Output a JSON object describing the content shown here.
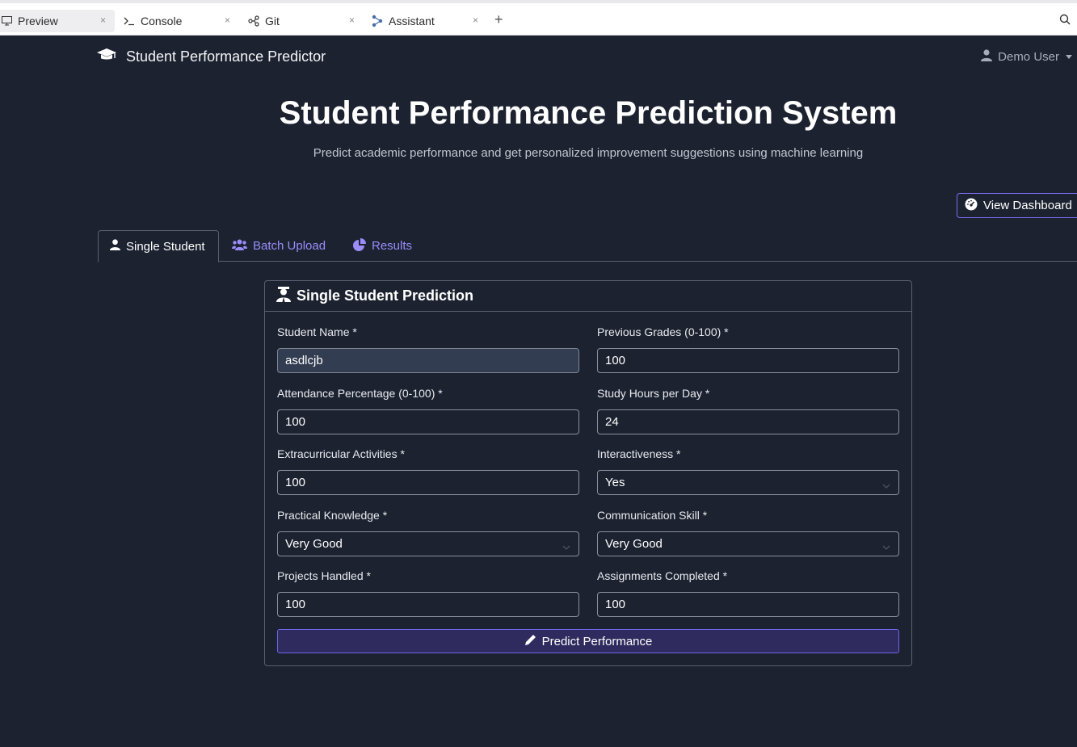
{
  "ide": {
    "tabs": [
      {
        "label": "Preview",
        "icon": "monitor-icon"
      },
      {
        "label": "Console",
        "icon": "terminal-icon"
      },
      {
        "label": "Git",
        "icon": "git-icon"
      },
      {
        "label": "Assistant",
        "icon": "assistant-icon"
      }
    ],
    "close_glyph": "×",
    "new_tab_glyph": "+"
  },
  "navbar": {
    "brand": "Student Performance Predictor",
    "user": "Demo User"
  },
  "hero": {
    "title": "Student Performance Prediction System",
    "subtitle": "Predict academic performance and get personalized improvement suggestions using machine learning"
  },
  "dashboard_button": "View Dashboard",
  "tabs": [
    {
      "label": "Single Student",
      "active": true
    },
    {
      "label": "Batch Upload",
      "active": false
    },
    {
      "label": "Results",
      "active": false
    }
  ],
  "form": {
    "title": "Single Student Prediction",
    "fields": {
      "student_name": {
        "label": "Student Name *",
        "value": "asdlcjb"
      },
      "previous_grades": {
        "label": "Previous Grades (0-100) *",
        "value": "100"
      },
      "attendance": {
        "label": "Attendance Percentage (0-100) *",
        "value": "100"
      },
      "study_hours": {
        "label": "Study Hours per Day *",
        "value": "24"
      },
      "extracurricular": {
        "label": "Extracurricular Activities *",
        "value": "100"
      },
      "interactiveness": {
        "label": "Interactiveness *",
        "value": "Yes"
      },
      "practical_knowledge": {
        "label": "Practical Knowledge *",
        "value": "Very Good"
      },
      "communication_skill": {
        "label": "Communication Skill *",
        "value": "Very Good"
      },
      "projects_handled": {
        "label": "Projects Handled *",
        "value": "100"
      },
      "assignments_completed": {
        "label": "Assignments Completed *",
        "value": "100"
      }
    },
    "submit": "Predict Performance"
  },
  "colors": {
    "background": "#1c2230",
    "accent": "#7c6cf0",
    "link": "#9b8cfb"
  }
}
